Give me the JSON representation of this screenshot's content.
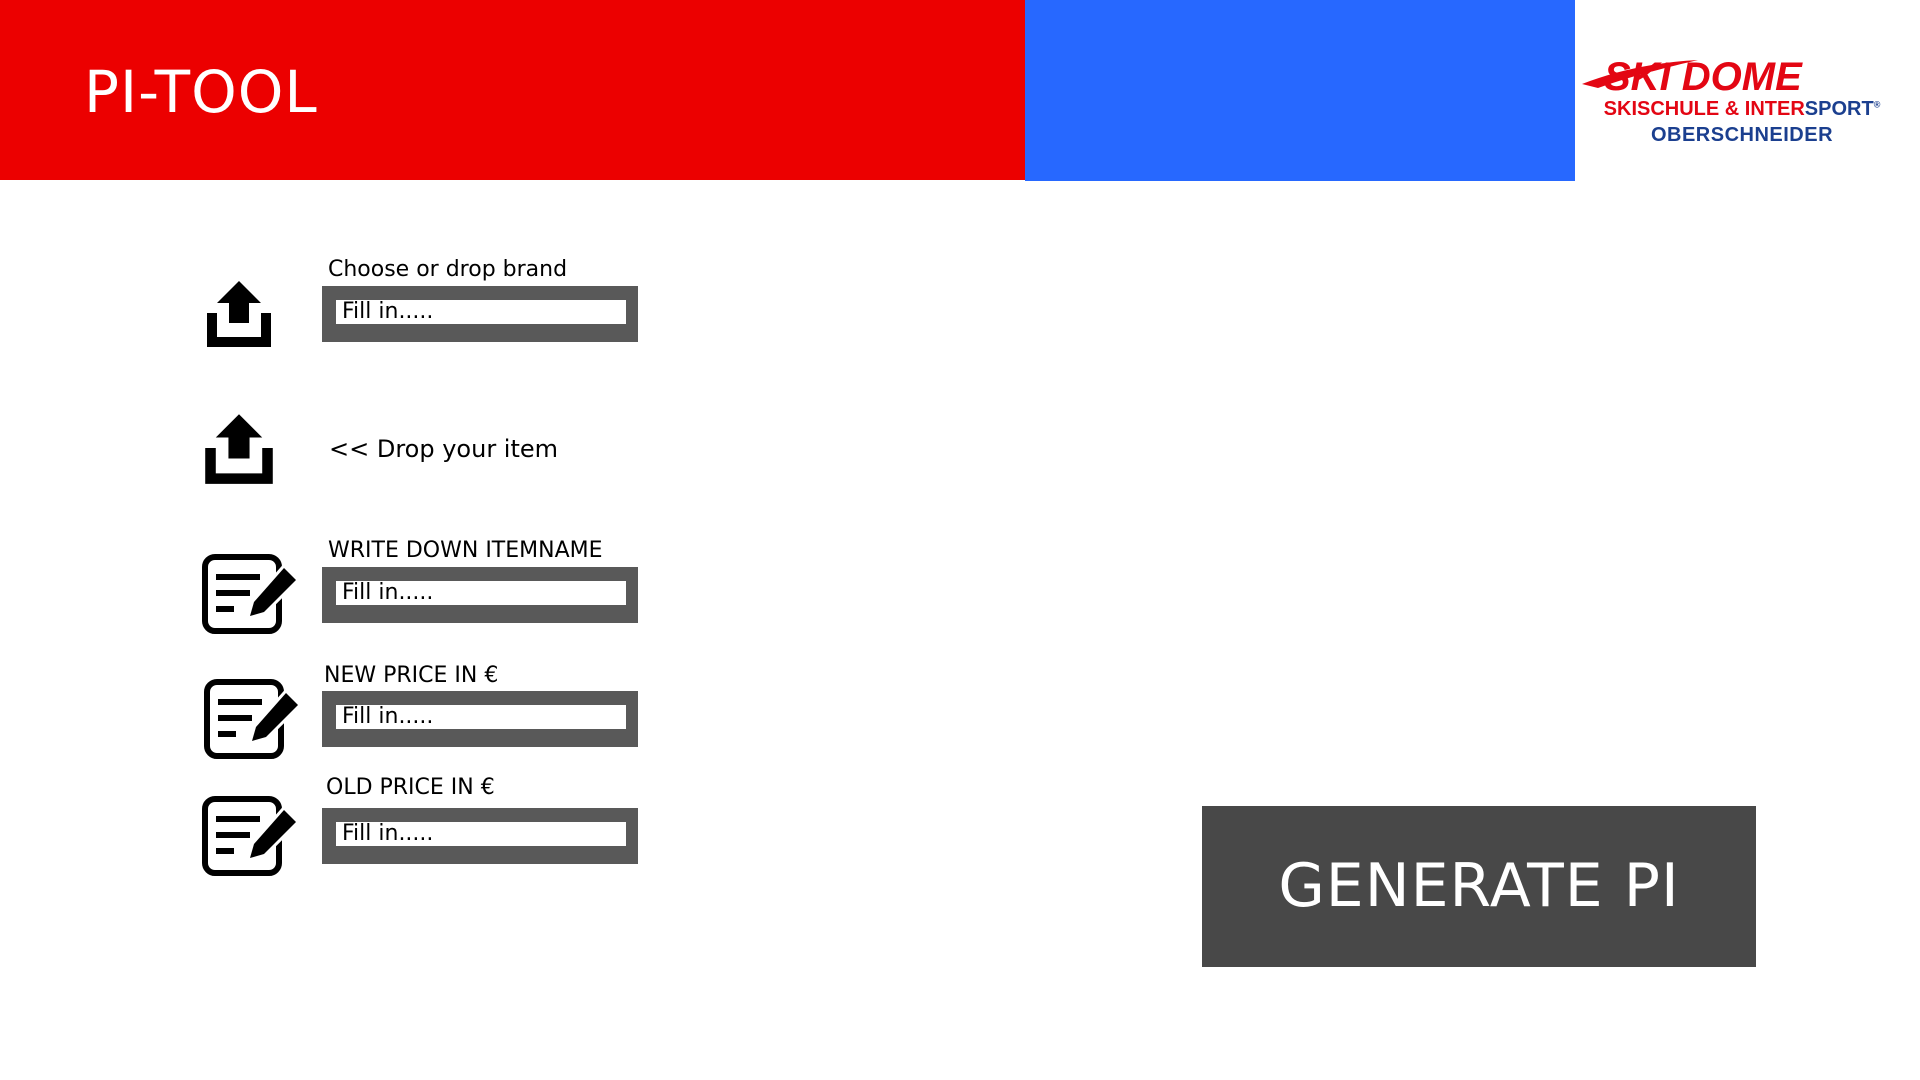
{
  "header": {
    "title": "PI-TOOL",
    "colors": {
      "red": "#ec0000",
      "blue": "#2768ff"
    }
  },
  "logo": {
    "main_text": "SKI DOME",
    "line2_red": "SKISCHULE & INTER",
    "line2_blue": "SPORT",
    "line2_mark": "®",
    "line3": "OBERSCHNEIDER"
  },
  "form": {
    "brand": {
      "label": "Choose or drop brand",
      "placeholder": "Fill in.....",
      "icon": "upload-icon"
    },
    "item_drop": {
      "text": "<< Drop your item",
      "icon": "upload-icon"
    },
    "itemname": {
      "label": "WRITE DOWN ITEMNAME",
      "placeholder": "Fill in.....",
      "icon": "edit-form-icon"
    },
    "new_price": {
      "label": "NEW PRICE IN €",
      "placeholder": "Fill in.....",
      "icon": "edit-form-icon"
    },
    "old_price": {
      "label": "OLD PRICE IN €",
      "placeholder": "Fill in.....",
      "icon": "edit-form-icon"
    }
  },
  "actions": {
    "generate_label": "GENERATE PI",
    "generate_color": "#484848"
  }
}
